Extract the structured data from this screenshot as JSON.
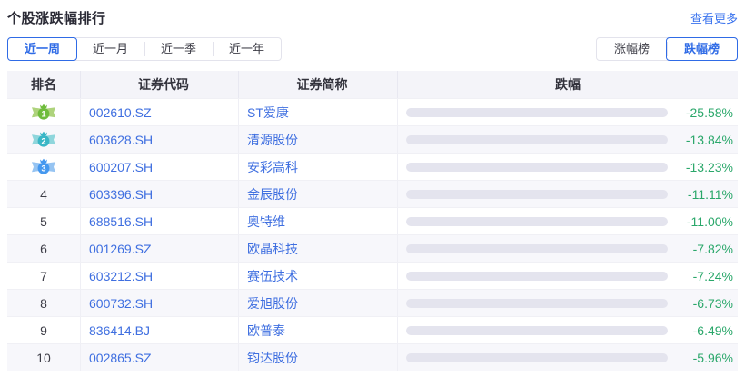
{
  "header": {
    "title": "个股涨跌幅排行",
    "more_link": "查看更多"
  },
  "filters": {
    "period_tabs": [
      {
        "label": "近一周",
        "selected": true
      },
      {
        "label": "近一月",
        "selected": false
      },
      {
        "label": "近一季",
        "selected": false
      },
      {
        "label": "近一年",
        "selected": false
      }
    ],
    "board_tabs": [
      {
        "label": "涨幅榜",
        "selected": false
      },
      {
        "label": "跌幅榜",
        "selected": true
      }
    ]
  },
  "table": {
    "columns": [
      "排名",
      "证券代码",
      "证券简称",
      "跌幅"
    ],
    "max_value": 25.58,
    "rows": [
      {
        "rank": 1,
        "code": "002610.SZ",
        "name": "ST爱康",
        "change": "-25.58%",
        "value": 25.58
      },
      {
        "rank": 2,
        "code": "603628.SH",
        "name": "清源股份",
        "change": "-13.84%",
        "value": 13.84
      },
      {
        "rank": 3,
        "code": "600207.SH",
        "name": "安彩高科",
        "change": "-13.23%",
        "value": 13.23
      },
      {
        "rank": 4,
        "code": "603396.SH",
        "name": "金辰股份",
        "change": "-11.11%",
        "value": 11.11
      },
      {
        "rank": 5,
        "code": "688516.SH",
        "name": "奥特维",
        "change": "-11.00%",
        "value": 11.0
      },
      {
        "rank": 6,
        "code": "001269.SZ",
        "name": "欧晶科技",
        "change": "-7.82%",
        "value": 7.82
      },
      {
        "rank": 7,
        "code": "603212.SH",
        "name": "赛伍技术",
        "change": "-7.24%",
        "value": 7.24
      },
      {
        "rank": 8,
        "code": "600732.SH",
        "name": "爱旭股份",
        "change": "-6.73%",
        "value": 6.73
      },
      {
        "rank": 9,
        "code": "836414.BJ",
        "name": "欧普泰",
        "change": "-6.49%",
        "value": 6.49
      },
      {
        "rank": 10,
        "code": "002865.SZ",
        "name": "钧达股份",
        "change": "-5.96%",
        "value": 5.96
      }
    ]
  },
  "medals": {
    "1": {
      "wing": "#aed37c",
      "body": "#6fbc3c"
    },
    "2": {
      "wing": "#8fd6dc",
      "body": "#3ab6c6"
    },
    "3": {
      "wing": "#96c4f2",
      "body": "#4598ef"
    }
  },
  "colors": {
    "accent_blue": "#2f6be6",
    "link_blue": "#3f6fe0",
    "bar_green": "#2cbd76",
    "pct_green": "#2aa76a",
    "track_gray": "#e4e4ee",
    "header_bg": "#f4f4f9"
  }
}
